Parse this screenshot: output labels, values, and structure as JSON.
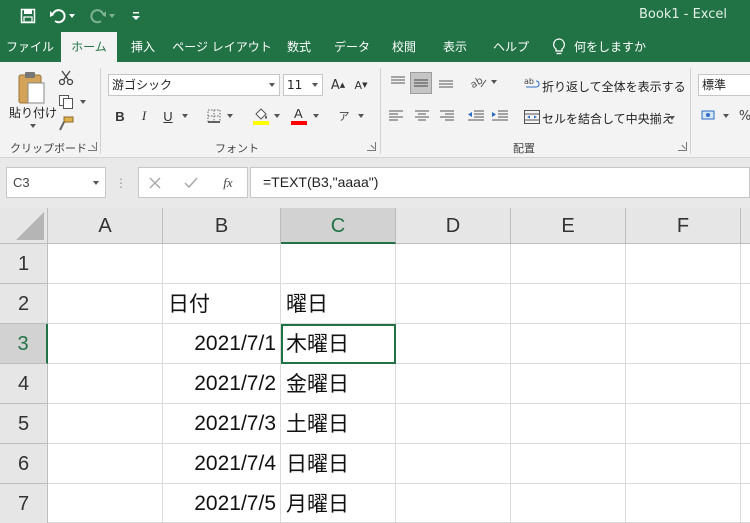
{
  "window": {
    "title": "Book1 - Excel"
  },
  "quick_access": {
    "save_icon": "save-icon",
    "undo_icon": "undo-icon",
    "redo_icon": "redo-icon",
    "customize_icon": "customize-qat-icon"
  },
  "ribbon_tabs": [
    {
      "label": "ファイル"
    },
    {
      "label": "ホーム"
    },
    {
      "label": "挿入"
    },
    {
      "label": "ページ レイアウト"
    },
    {
      "label": "数式"
    },
    {
      "label": "データ"
    },
    {
      "label": "校閲"
    },
    {
      "label": "表示"
    },
    {
      "label": "ヘルプ"
    },
    {
      "label": "何をしますか"
    }
  ],
  "ribbon": {
    "clipboard": {
      "paste_label": "貼り付け",
      "group_label": "クリップボード"
    },
    "font": {
      "font_name": "游ゴシック",
      "font_size": "11",
      "bold": "B",
      "italic": "I",
      "underline": "U",
      "group_label": "フォント",
      "font_color": "#ff0000",
      "fill_color": "#ffff00"
    },
    "alignment": {
      "wrap_text": "折り返して全体を表示する",
      "merge_center": "セルを結合して中央揃え",
      "group_label": "配置"
    },
    "number": {
      "format": "標準",
      "percent": "%"
    }
  },
  "formula_bar": {
    "name_box": "C3",
    "formula": "=TEXT(B3,\"aaaa\")",
    "fx_label": "fx"
  },
  "columns": [
    "A",
    "B",
    "C",
    "D",
    "E",
    "F"
  ],
  "rows": [
    {
      "num": "1",
      "b": "",
      "c": ""
    },
    {
      "num": "2",
      "b": "日付",
      "c": "曜日"
    },
    {
      "num": "3",
      "b": "2021/7/1",
      "c": "木曜日"
    },
    {
      "num": "4",
      "b": "2021/7/2",
      "c": "金曜日"
    },
    {
      "num": "5",
      "b": "2021/7/3",
      "c": "土曜日"
    },
    {
      "num": "6",
      "b": "2021/7/4",
      "c": "日曜日"
    },
    {
      "num": "7",
      "b": "2021/7/5",
      "c": "月曜日"
    }
  ],
  "theme": {
    "accent": "#217346"
  }
}
